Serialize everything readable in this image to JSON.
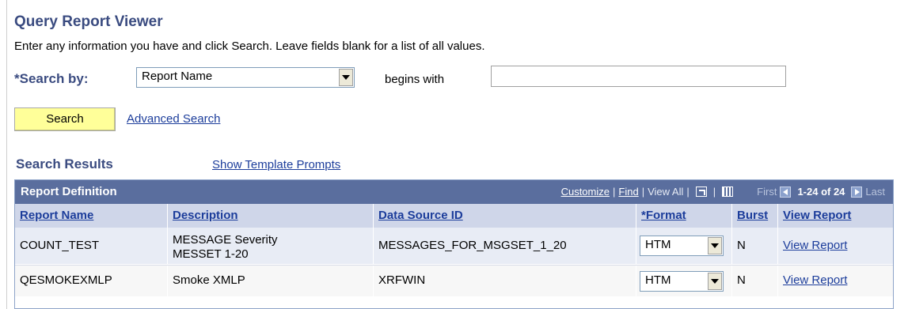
{
  "header": {
    "title": "Query Report Viewer",
    "instructions": "Enter any information you have and click Search. Leave fields blank for a list of all values."
  },
  "search": {
    "required_marker": "*",
    "label": "Search by:",
    "field_selected": "Report Name",
    "operator": "begins with",
    "value": "",
    "search_button": "Search",
    "advanced_link": "Advanced Search"
  },
  "results": {
    "title": "Search Results",
    "show_template_link": "Show Template Prompts",
    "grid": {
      "caption": "Report Definition",
      "customize": "Customize",
      "find": "Find",
      "view_all": "View All",
      "first": "First",
      "range": "1-24 of 24",
      "last": "Last",
      "columns": [
        "Report Name",
        "Description",
        "Data Source ID",
        "*Format",
        "Burst",
        "View Report"
      ],
      "rows": [
        {
          "report_name": "COUNT_TEST",
          "description_line1": "MESSAGE Severity",
          "description_line2": "MESSET 1-20",
          "data_source_id": "MESSAGES_FOR_MSGSET_1_20",
          "format": "HTM",
          "burst": "N",
          "view_report": "View Report"
        },
        {
          "report_name": "QESMOKEXMLP",
          "description_line1": "Smoke XMLP",
          "description_line2": "",
          "data_source_id": "XRFWIN",
          "format": "HTM",
          "burst": "N",
          "view_report": "View Report"
        }
      ]
    }
  },
  "colors": {
    "title": "#3a4b80",
    "grid_header": "#5a6e9e",
    "column_header": "#cfd6e9",
    "link": "#1c3d9b",
    "search_button": "#ffff99"
  }
}
